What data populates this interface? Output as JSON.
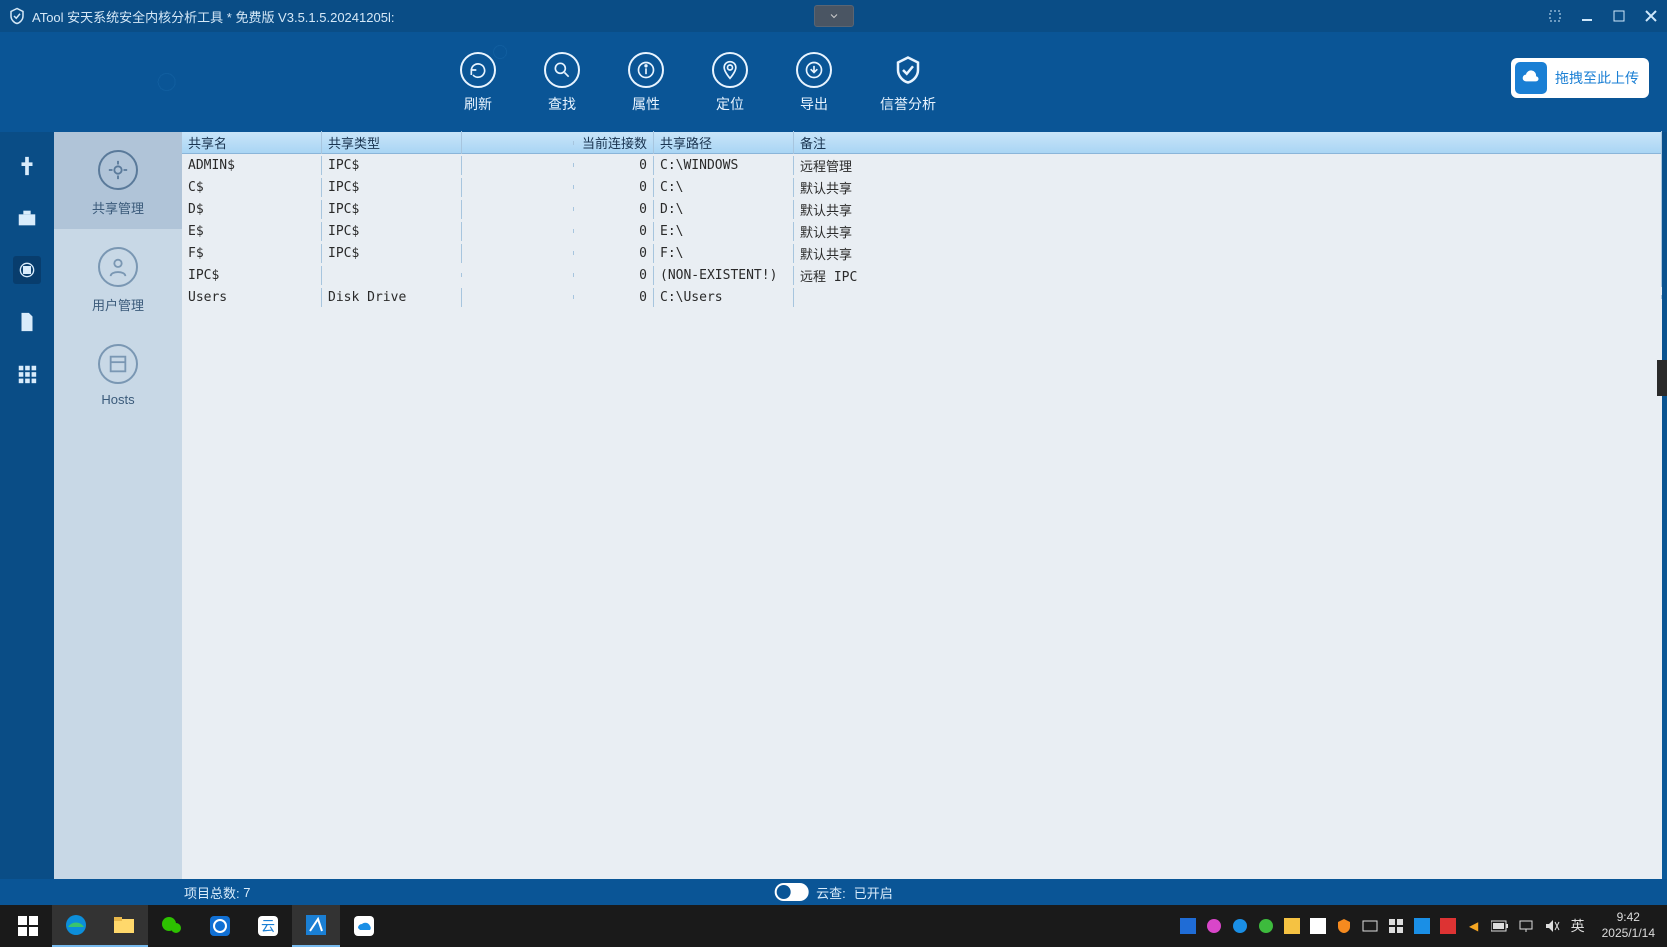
{
  "title": "ATool 安天系统安全内核分析工具 * 免费版 V3.5.1.5.20241205l:",
  "toolbar": {
    "refresh": "刷新",
    "search": "查找",
    "properties": "属性",
    "locate": "定位",
    "export": "导出",
    "reputation": "信誉分析"
  },
  "upload_label": "拖拽至此上传",
  "sub_sidebar": [
    {
      "label": "共享管理"
    },
    {
      "label": "用户管理"
    },
    {
      "label": "Hosts"
    }
  ],
  "columns": {
    "name": "共享名",
    "type": "共享类型",
    "conn": "当前连接数",
    "path": "共享路径",
    "note": "备注"
  },
  "rows": [
    {
      "name": "ADMIN$",
      "type": "IPC$",
      "conn": "0",
      "path": "C:\\WINDOWS",
      "note": "远程管理"
    },
    {
      "name": "C$",
      "type": "IPC$",
      "conn": "0",
      "path": "C:\\",
      "note": "默认共享"
    },
    {
      "name": "D$",
      "type": "IPC$",
      "conn": "0",
      "path": "D:\\",
      "note": "默认共享"
    },
    {
      "name": "E$",
      "type": "IPC$",
      "conn": "0",
      "path": "E:\\",
      "note": "默认共享"
    },
    {
      "name": "F$",
      "type": "IPC$",
      "conn": "0",
      "path": "F:\\",
      "note": "默认共享"
    },
    {
      "name": "IPC$",
      "type": "",
      "conn": "0",
      "path": "(NON-EXISTENT!)",
      "note": "远程 IPC"
    },
    {
      "name": "Users",
      "type": "Disk Drive",
      "conn": "0",
      "path": "C:\\Users",
      "note": ""
    }
  ],
  "status": {
    "count_label": "项目总数:",
    "count_value": "7",
    "cloud_label": "云查:",
    "cloud_value": "已开启"
  },
  "taskbar": {
    "ime": "英",
    "time": "9:42",
    "date": "2025/1/14"
  }
}
